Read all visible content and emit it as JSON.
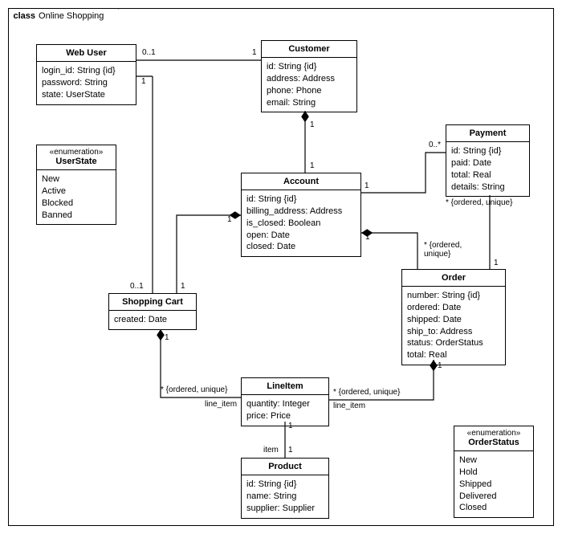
{
  "frame": {
    "keyword": "class",
    "name": "Online Shopping"
  },
  "webUser": {
    "title": "Web User",
    "attrs": "login_id: String {id}\npassword: String\nstate: UserState"
  },
  "userState": {
    "stereo": "«enumeration»",
    "title": "UserState",
    "attrs": "New\nActive\nBlocked\nBanned"
  },
  "customer": {
    "title": "Customer",
    "attrs": "id: String {id}\naddress: Address\nphone: Phone\nemail: String"
  },
  "account": {
    "title": "Account",
    "attrs": "id: String {id}\nbilling_address: Address\nis_closed: Boolean\nopen: Date\nclosed: Date"
  },
  "shoppingCart": {
    "title": "Shopping Cart",
    "attrs": "created: Date"
  },
  "payment": {
    "title": "Payment",
    "attrs": "id: String {id}\npaid: Date\ntotal: Real\ndetails: String"
  },
  "order": {
    "title": "Order",
    "attrs": "number: String {id}\nordered: Date\nshipped: Date\nship_to: Address\nstatus: OrderStatus\ntotal: Real"
  },
  "lineItem": {
    "title": "LineItem",
    "attrs": "quantity: Integer\nprice: Price"
  },
  "product": {
    "title": "Product",
    "attrs": "id: String {id}\nname: String\nsupplier: Supplier"
  },
  "orderStatus": {
    "stereo": "«enumeration»",
    "title": "OrderStatus",
    "attrs": "New\nHold\nShipped\nDelivered\nClosed"
  },
  "labels": {
    "webUserCustomer_l": "0..1",
    "webUserCustomer_r": "1",
    "webUserCart_t": "1",
    "webUserCart_b": "0..1",
    "customerAccount_t": "1",
    "customerAccount_b": "1",
    "accountCart_l": "1",
    "accountCart_r": "1",
    "accountPayment_l": "1",
    "accountPayment_r": "0..*",
    "accountOrder_l": "1",
    "accountOrder_r": "* {ordered,\nunique}",
    "orderPayment_b": "1",
    "orderPayment_t": "* {ordered, unique}",
    "cartLine_t": "1",
    "cartLine_b": "* {ordered, unique}",
    "cartLine_role": "line_item",
    "orderLine_t": "1",
    "orderLine_b": "* {ordered, unique}",
    "orderLine_role": "line_item",
    "lineProduct_t": "1",
    "lineProduct_b": "1",
    "lineProduct_role": "item"
  }
}
